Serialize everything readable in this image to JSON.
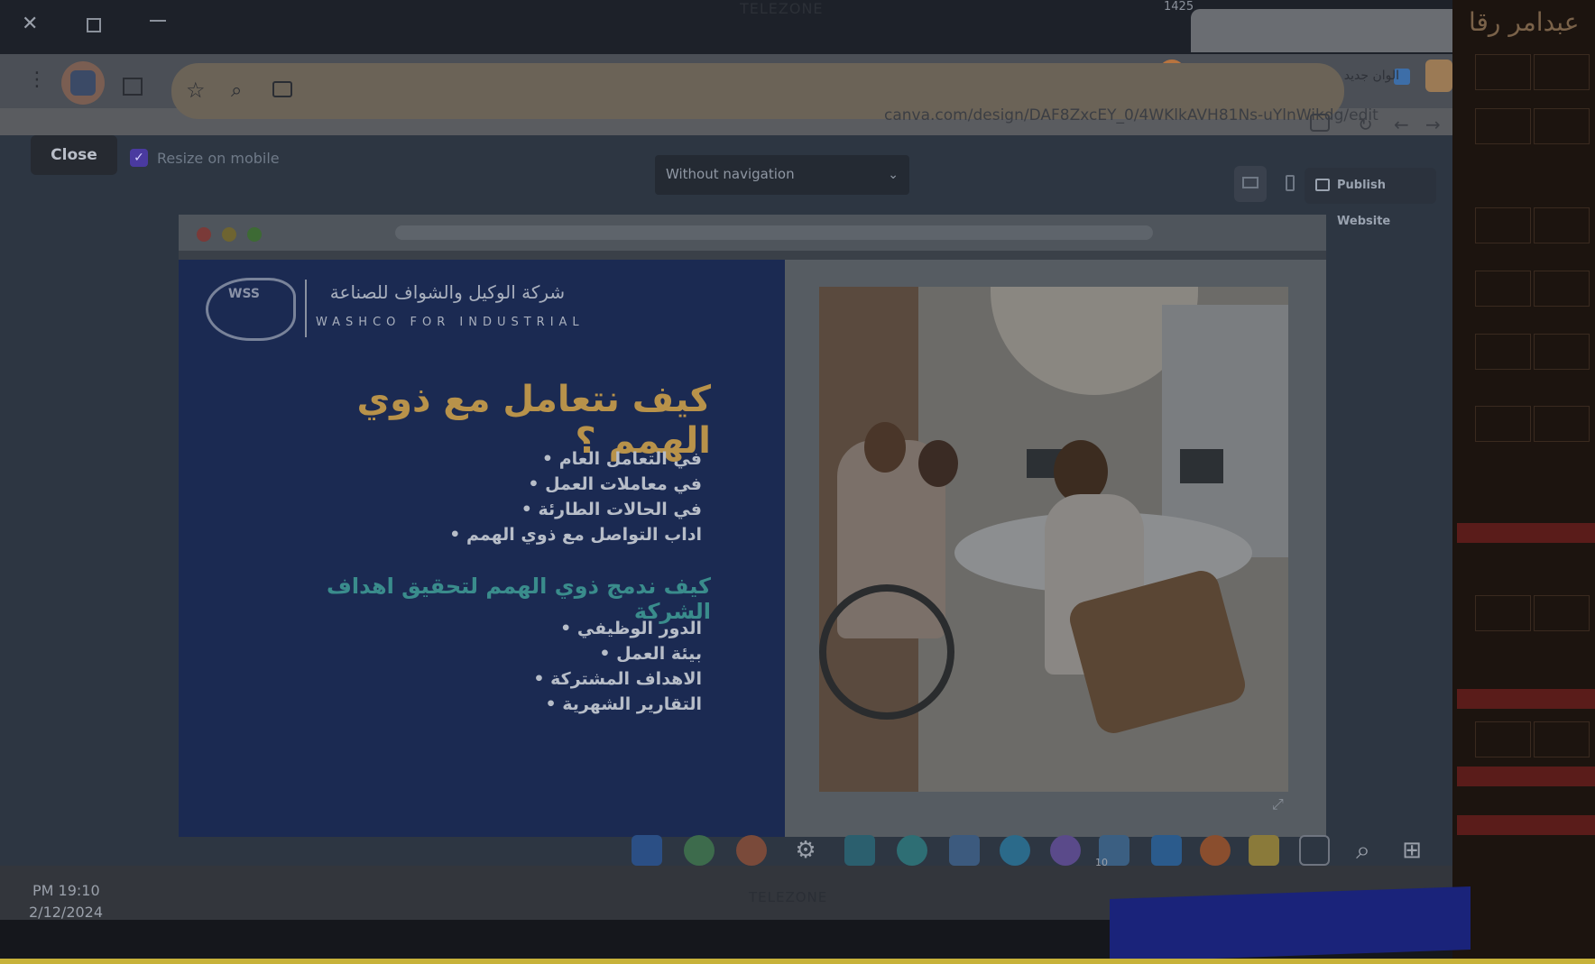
{
  "monitor": {
    "brand_top": "TELEZONE",
    "brand_bottom": "TELEZONE",
    "corner_arabic": "عبدامر رقا",
    "top_counter": "1425"
  },
  "browser": {
    "tab": {
      "title": "ﺍﻟﻮﺍﻥ ﺟﺪﻳﺪ - Website",
      "close_icon": "close-icon"
    },
    "new_tab_label": "+",
    "url": "canva.com/design/DAF8ZxcEY_0/4WKlkAVH81Ns-uYlnWikdg/edit",
    "icons": [
      "kebab-menu-icon",
      "profile-icon",
      "side-panel-icon",
      "star-icon",
      "zoom-icon",
      "cast-icon",
      "site-settings-icon",
      "reload-icon",
      "back-icon",
      "forward-icon"
    ]
  },
  "canva_toolbar": {
    "close_label": "Close",
    "resize_label": "Resize on mobile",
    "resize_checked": true,
    "navigation_select": "Without navigation",
    "publish_label": "Publish Website"
  },
  "slide": {
    "logo_text": "WSS",
    "company_ar": "شركة الوكيل والشواف للصناعة",
    "company_en": "WASHCO FOR INDUSTRIAL",
    "heading_1": "كيف نتعامل مع ذوي الهمم ؟",
    "list_1": [
      "في التعامل العام",
      "في معاملات العمل",
      "في الحالات الطارئة",
      "اداب التواصل مع ذوي الهمم"
    ],
    "heading_2": "كيف ندمج ذوي الهمم لتحقيق اهداف الشركة",
    "list_2": [
      "الدور الوظيفي",
      "بيئة العمل",
      "الاهداف المشتركة",
      "التقارير الشهرية"
    ],
    "photo_description_icon": "office-meeting-photo"
  },
  "taskbar": {
    "time": "PM 19:10",
    "date": "2/12/2024",
    "badge": "10"
  },
  "colors": {
    "slide_bg": "#1b2a52",
    "heading_gold": "#b8924a",
    "heading_teal": "#3a8c8c",
    "publish_accent": "#2b323d"
  }
}
